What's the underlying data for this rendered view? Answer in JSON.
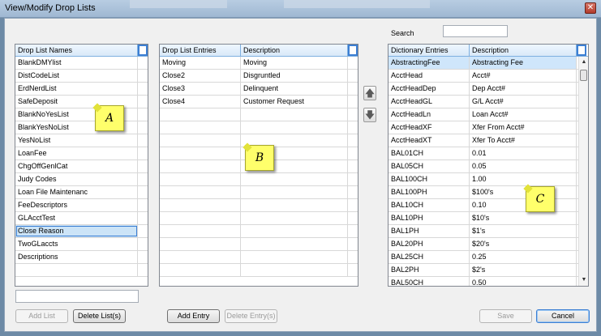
{
  "window": {
    "title": "View/Modify Drop Lists",
    "close_glyph": "✕"
  },
  "search": {
    "label": "Search",
    "value": ""
  },
  "drop_list_names": {
    "header": "Drop List Names",
    "items": [
      "BlankDMYlist",
      "DistCodeList",
      "ErdNerdList",
      "SafeDeposit",
      "BlankNoYesList",
      "BlankYesNoList",
      "YesNoList",
      "LoanFee",
      "ChgOffGenlCat",
      "Judy Codes",
      "Loan File Maintenanc",
      "FeeDescriptors",
      "GLAcctTest",
      "Close Reason",
      "TwoGLaccts",
      "Descriptions"
    ],
    "selected": "Close Reason"
  },
  "new_list_input": {
    "value": ""
  },
  "drop_list_entries": {
    "headers": [
      "Drop List Entries",
      "Description"
    ],
    "rows": [
      [
        "Moving",
        "Moving"
      ],
      [
        "Close2",
        "Disgruntled"
      ],
      [
        "Close3",
        "Delinquent"
      ],
      [
        "Close4",
        "Customer Request"
      ]
    ]
  },
  "dictionary": {
    "headers": [
      "Dictionary Entries",
      "Description"
    ],
    "rows": [
      [
        "AbstractingFee",
        "Abstracting Fee"
      ],
      [
        "AcctHead",
        "Acct#"
      ],
      [
        "AcctHeadDep",
        "Dep Acct#"
      ],
      [
        "AcctHeadGL",
        "G/L Acct#"
      ],
      [
        "AcctHeadLn",
        "Loan Acct#"
      ],
      [
        "AcctHeadXF",
        "Xfer From Acct#"
      ],
      [
        "AcctHeadXT",
        "Xfer To Acct#"
      ],
      [
        "BAL01CH",
        "0.01"
      ],
      [
        "BAL05CH",
        "0.05"
      ],
      [
        "BAL100CH",
        "1.00"
      ],
      [
        "BAL100PH",
        "$100's"
      ],
      [
        "BAL10CH",
        "0.10"
      ],
      [
        "BAL10PH",
        "$10's"
      ],
      [
        "BAL1PH",
        "$1's"
      ],
      [
        "BAL20PH",
        "$20's"
      ],
      [
        "BAL25CH",
        "0.25"
      ],
      [
        "BAL2PH",
        "$2's"
      ],
      [
        "BAL50CH",
        "0.50"
      ]
    ],
    "highlighted": "AbstractingFee"
  },
  "notes": {
    "a": "A",
    "b": "B",
    "c": "C"
  },
  "arrows": {
    "up": "🡅",
    "down": "🡇"
  },
  "buttons": {
    "add_list": "Add List",
    "delete_list": "Delete List(s)",
    "add_entry": "Add Entry",
    "delete_entry": "Delete Entry(s)",
    "save": "Save",
    "cancel": "Cancel"
  },
  "scroll_glyphs": {
    "up": "▲",
    "down": "▼"
  }
}
